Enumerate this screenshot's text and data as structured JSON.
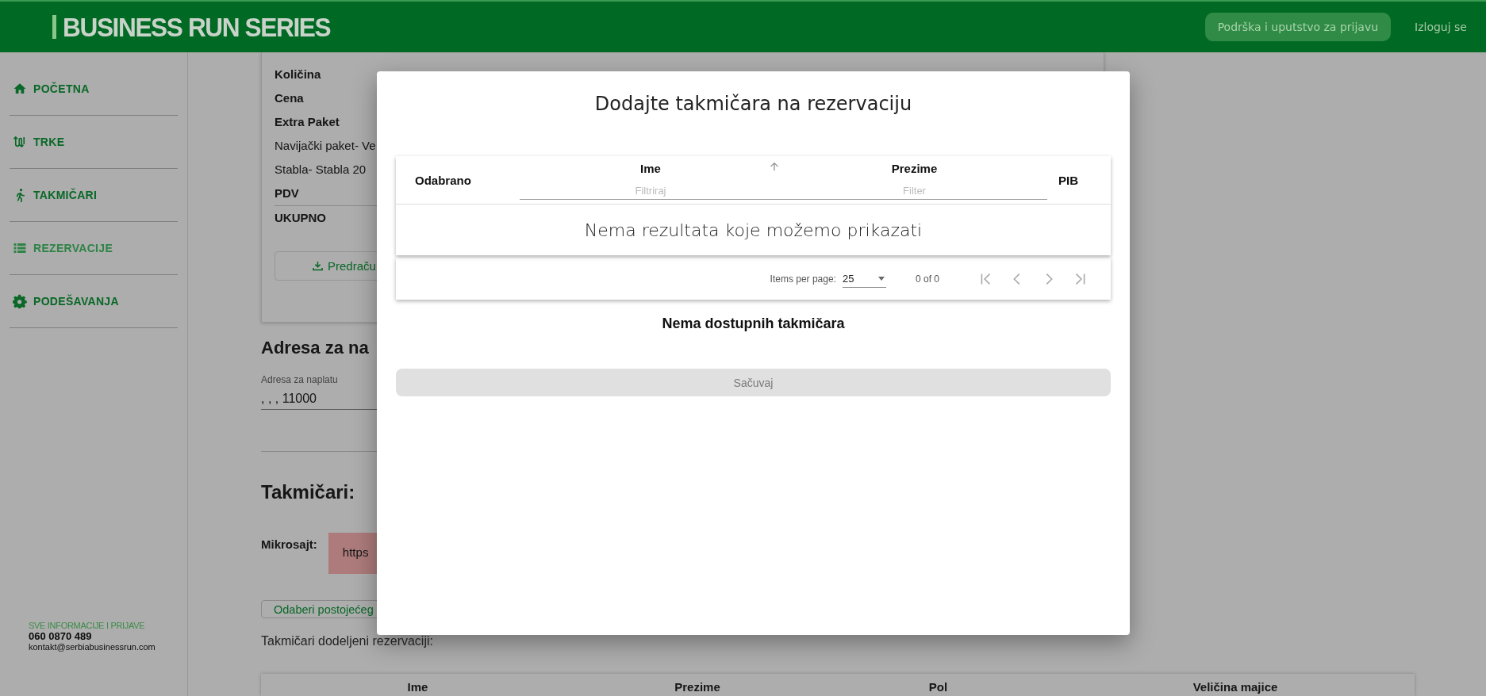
{
  "header": {
    "logo": "BUSINESS RUN SERIES",
    "support_button": "Podrška i uputstvo za prijavu",
    "logout_link": "Izloguj se"
  },
  "sidebar": {
    "items": [
      {
        "label": "POČETNA",
        "kind": "home",
        "selected": false
      },
      {
        "label": "TRKE",
        "kind": "route",
        "selected": false
      },
      {
        "label": "TAKMIČARI",
        "kind": "runner",
        "selected": false
      },
      {
        "label": "REZERVACIJE",
        "kind": "list",
        "selected": true
      },
      {
        "label": "PODEŠAVANJA",
        "kind": "gear",
        "selected": false
      }
    ],
    "contact": {
      "heading": "SVE INFORMACIJE I PRIJAVE",
      "phone": "060 0870 489",
      "email": "kontakt@serbiabusinessrun.com"
    }
  },
  "order_summary": {
    "rows": [
      {
        "text": "Količina",
        "kind": "label"
      },
      {
        "text": "Cena",
        "kind": "label"
      },
      {
        "text": "Extra Paket",
        "kind": "label"
      },
      {
        "text": "Navijački paket- Ve",
        "kind": "item"
      },
      {
        "text": "Stabla- Stabla 20",
        "kind": "item"
      },
      {
        "text": "PDV",
        "kind": "label"
      },
      {
        "text": "UKUPNO",
        "kind": "total"
      }
    ],
    "download_button": "Predraču"
  },
  "billing": {
    "heading": "Adresa za na",
    "field_label": "Adresa za naplatu",
    "field_value": ", , , 11000"
  },
  "competitors": {
    "heading": "Takmičari:",
    "microsite_label": "Mikrosajt:",
    "microsite_url": "https",
    "select_existing_button": "Odaberi postojećeg",
    "assigned_label": "Takmičari dodeljeni rezervaciji:",
    "table_columns": [
      "Ime",
      "Prezime",
      "Pol",
      "Veličina majice"
    ]
  },
  "modal": {
    "title": "Dodajte takmičara na rezervaciju",
    "table": {
      "columns": [
        {
          "label": "Odabrano"
        },
        {
          "label": "Ime",
          "sorted": true,
          "filter_placeholder": "Filtriraj"
        },
        {
          "label": "Prezime",
          "sorted": false,
          "filter_placeholder": "Filter"
        },
        {
          "label": "PIB"
        }
      ],
      "empty_message": "Nema rezultata koje možemo prikazati",
      "paginator": {
        "items_per_page_label": "Items per page:",
        "page_size": "25",
        "range": "0 of 0",
        "nav_disabled": true
      }
    },
    "message": "Nema dostupnih takmičara",
    "save_button": {
      "label": "Sačuvaj",
      "disabled": true
    }
  }
}
